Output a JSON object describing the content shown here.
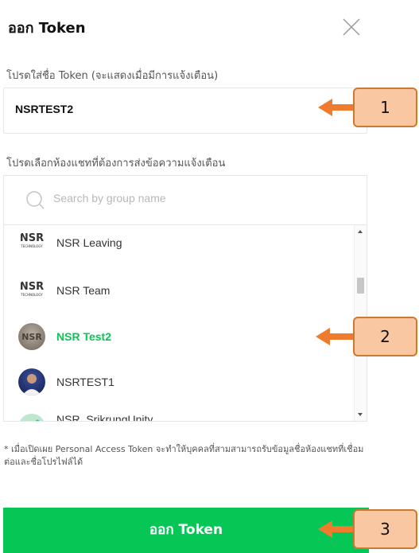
{
  "dialog": {
    "title": "ออก Token",
    "close_icon": "close-x-icon"
  },
  "token": {
    "label": "โปรดใส่ชื่อ Token (จะแสดงเมื่อมีการแจ้งเตือน)",
    "value": "NSRTEST2"
  },
  "chat": {
    "label": "โปรดเลือกห้องแชทที่ต้องการส่งข้อความแจ้งเตือน",
    "search_placeholder": "Search by group name",
    "search_icon": "search-icon",
    "items": [
      {
        "name": "NSR Leaving",
        "selected": false,
        "avatar": "nsr-technology-logo"
      },
      {
        "name": "NSR Team",
        "selected": false,
        "avatar": "nsr-technology-logo"
      },
      {
        "name": "NSR Test2",
        "selected": true,
        "avatar": "nsr-photo"
      },
      {
        "name": "NSRTEST1",
        "selected": false,
        "avatar": "person-photo"
      },
      {
        "name": "NSR_SrikrungUnity",
        "selected": false,
        "avatar": "leaf-pattern"
      }
    ]
  },
  "note": "* เมื่อเปิดเผย Personal Access Token จะทำให้บุคคลที่สามสามารถรับข้อมูลชื่อห้องแชทที่เชื่อมต่อและชื่อโปรไฟล์ได้",
  "submit_label": "ออก Token",
  "callouts": [
    "1",
    "2",
    "3"
  ],
  "colors": {
    "accent_green": "#06c755",
    "callout_fill": "#f9c8a2",
    "callout_border": "#cc7a32",
    "arrow": "#ef7b2f"
  }
}
